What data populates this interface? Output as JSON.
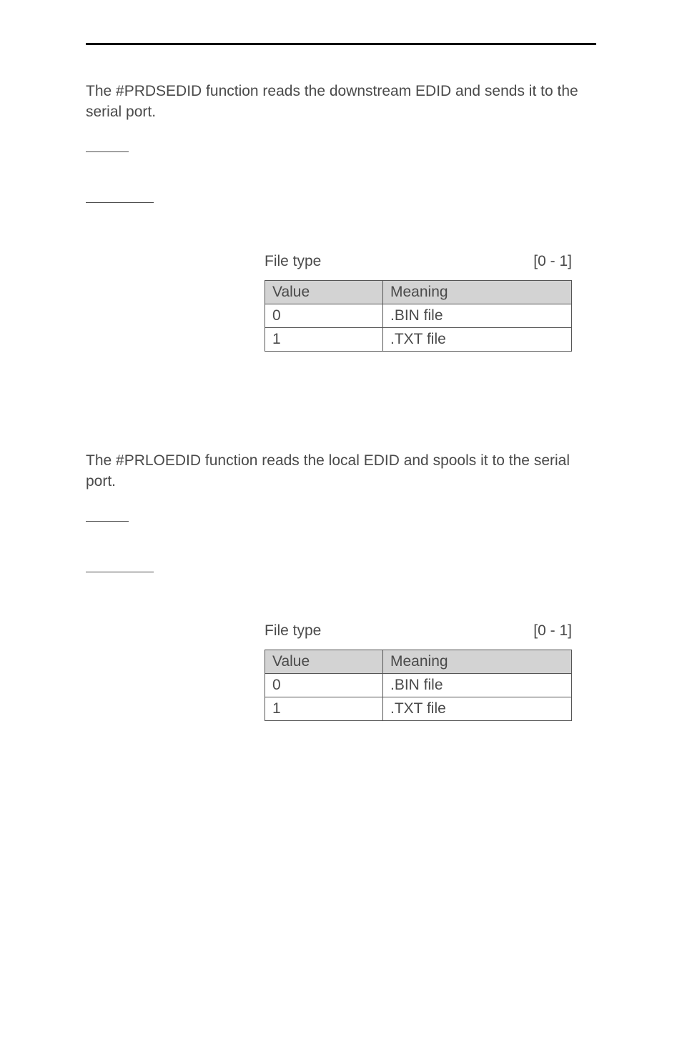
{
  "sections": [
    {
      "description": "The #PRDSEDID function reads the downstream EDID and sends it to the serial port.",
      "param": {
        "label": "File type",
        "range": "[0 - 1]",
        "table": {
          "headers": [
            "Value",
            "Meaning"
          ],
          "rows": [
            [
              "0",
              ".BIN file"
            ],
            [
              "1",
              ".TXT file"
            ]
          ]
        }
      }
    },
    {
      "description": "The #PRLOEDID function reads the local EDID and spools it to the serial port.",
      "param": {
        "label": "File type",
        "range": "[0 - 1]",
        "table": {
          "headers": [
            "Value",
            "Meaning"
          ],
          "rows": [
            [
              "0",
              ".BIN file"
            ],
            [
              "1",
              ".TXT file"
            ]
          ]
        }
      }
    }
  ]
}
